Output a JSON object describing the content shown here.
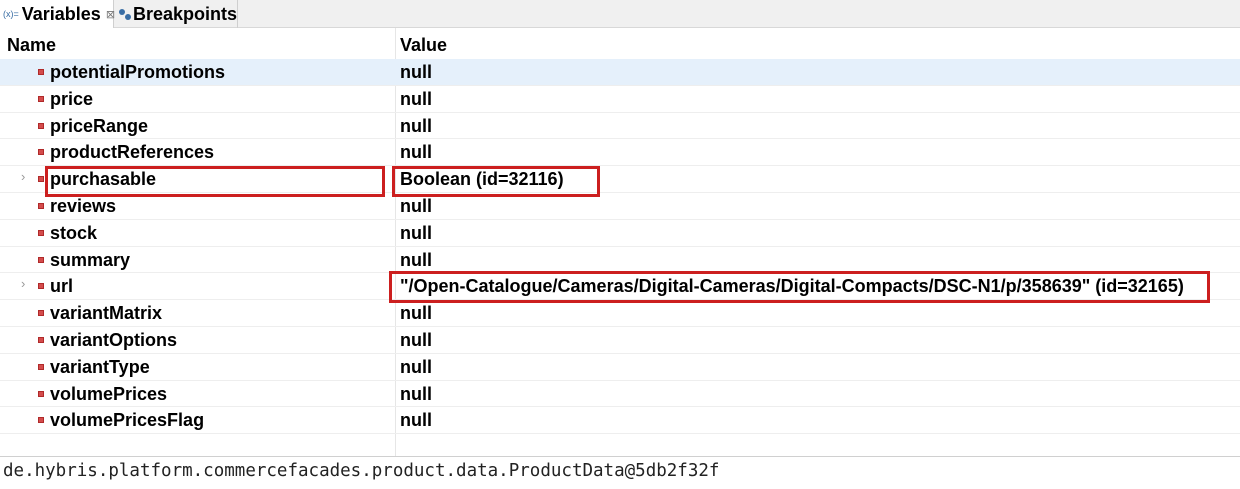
{
  "tabs": [
    {
      "label": "Variables",
      "icon": "variables-icon",
      "active": true,
      "close_glyph": "⊠"
    },
    {
      "label": "Breakpoints",
      "icon": "breakpoints-icon",
      "active": false
    }
  ],
  "columns": {
    "name": "Name",
    "value": "Value"
  },
  "rows": [
    {
      "name": "potentialPromotions",
      "value": "null",
      "expandable": false,
      "selected": true
    },
    {
      "name": "price",
      "value": "null",
      "expandable": false
    },
    {
      "name": "priceRange",
      "value": "null",
      "expandable": false
    },
    {
      "name": "productReferences",
      "value": "null",
      "expandable": false
    },
    {
      "name": "purchasable",
      "value": "Boolean  (id=32116)",
      "expandable": true,
      "highlighted": true
    },
    {
      "name": "reviews",
      "value": "null",
      "expandable": false
    },
    {
      "name": "stock",
      "value": "null",
      "expandable": false
    },
    {
      "name": "summary",
      "value": "null",
      "expandable": false
    },
    {
      "name": "url",
      "value": "\"/Open-Catalogue/Cameras/Digital-Cameras/Digital-Compacts/DSC-N1/p/358639\" (id=32165)",
      "expandable": true,
      "highlighted": true
    },
    {
      "name": "variantMatrix",
      "value": "null",
      "expandable": false
    },
    {
      "name": "variantOptions",
      "value": "null",
      "expandable": false
    },
    {
      "name": "variantType",
      "value": "null",
      "expandable": false
    },
    {
      "name": "volumePrices",
      "value": "null",
      "expandable": false
    },
    {
      "name": "volumePricesFlag",
      "value": "null",
      "expandable": false
    }
  ],
  "detail_text": "de.hybris.platform.commercefacades.product.data.ProductData@5db2f32f",
  "colors": {
    "highlight": "#cc1f1f",
    "selected_row": "#e5f0fb",
    "field_icon": "#d44c4c"
  }
}
